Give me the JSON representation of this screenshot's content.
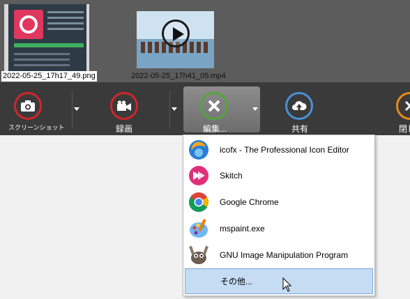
{
  "thumbnails": [
    {
      "label": "2022-05-25_17h17_49.png",
      "kind": "image"
    },
    {
      "label": "2022-05-25_17h41_05.mp4",
      "kind": "video"
    }
  ],
  "toolbar": {
    "screenshot": {
      "label": "スクリーンショット",
      "icon": "camera-icon",
      "color": "#d0262c"
    },
    "record": {
      "label": "録画",
      "icon": "video-camera-icon",
      "color": "#d0262c"
    },
    "edit": {
      "label": "編集...",
      "icon": "pencil-ruler-icon",
      "color": "#54a53a"
    },
    "share": {
      "label": "共有",
      "icon": "cloud-upload-icon",
      "color": "#4a90d9"
    },
    "close": {
      "label": "閉じ",
      "icon": "close-icon",
      "color": "#e88a1a"
    }
  },
  "menu": {
    "items": [
      {
        "label": "icofx - The Professional Icon Editor",
        "icon": "icofx-icon"
      },
      {
        "label": "Skitch",
        "icon": "skitch-icon"
      },
      {
        "label": "Google Chrome",
        "icon": "chrome-icon"
      },
      {
        "label": "mspaint.exe",
        "icon": "paint-icon"
      },
      {
        "label": "GNU Image Manipulation Program",
        "icon": "gimp-icon"
      },
      {
        "label": "その他...",
        "icon": "",
        "selected": true
      }
    ]
  }
}
